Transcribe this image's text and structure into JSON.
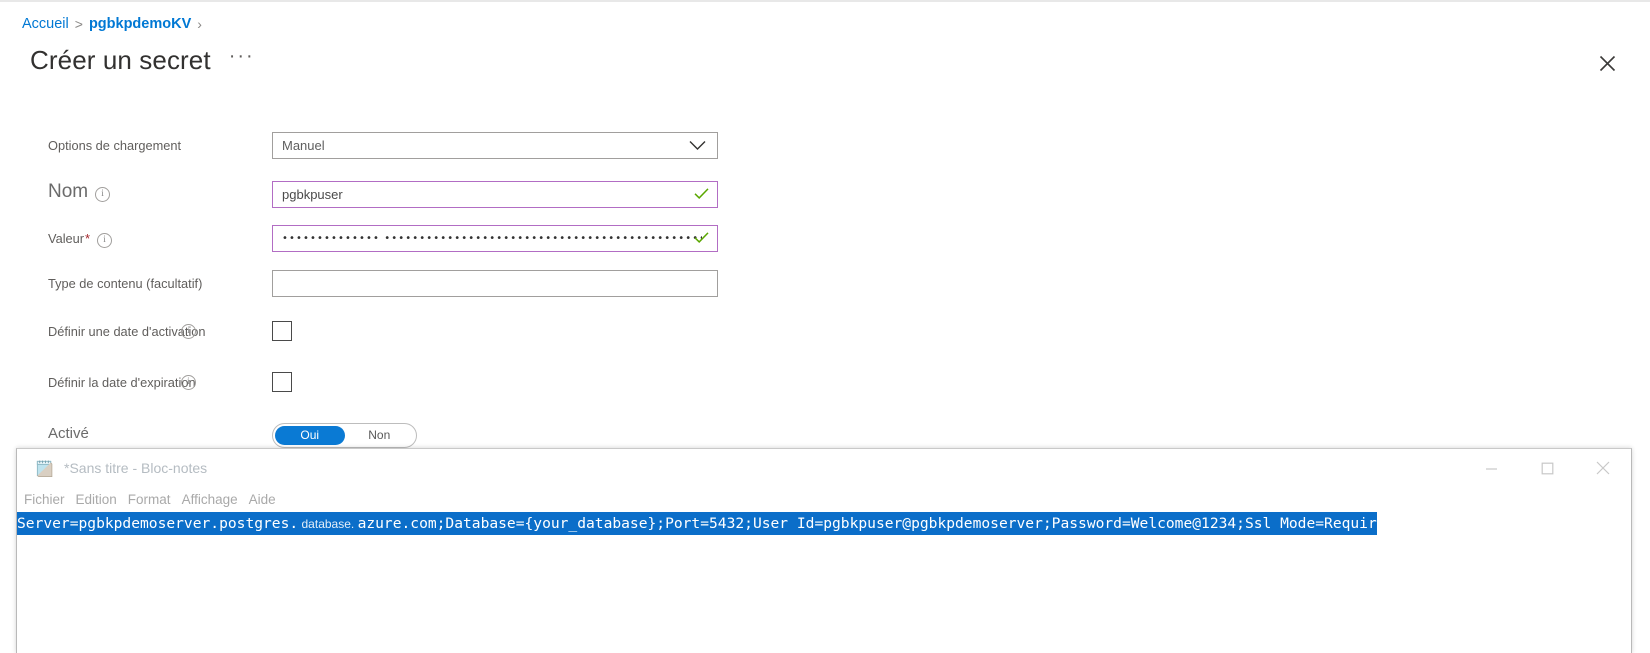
{
  "breadcrumb": {
    "home": "Accueil",
    "separator": ">",
    "current": "pgbkpdemoKV",
    "trailing": "›"
  },
  "blade": {
    "title": "Créer un secret",
    "more_label": "···",
    "close_icon": "close-icon"
  },
  "form": {
    "upload_options": {
      "label": "Options de chargement",
      "value": "Manuel",
      "chevron_icon": "chevron-down-icon"
    },
    "name": {
      "label": "Nom",
      "value": "pgbkpuser",
      "info_icon": "info-icon",
      "valid_icon": "check-icon"
    },
    "value": {
      "label": "Valeur",
      "required_marker": "*",
      "value": "•••••••••••••• •••••••••••••••••••••••••••••••••••••••••••••••••••••••••••••••••••••••••••••••••••",
      "info_icon": "info-icon",
      "valid_icon": "check-icon"
    },
    "content_type": {
      "label": "Type de contenu (facultatif)",
      "value": ""
    },
    "activation_date": {
      "label": "Définir une date d'activation",
      "checked": false
    },
    "expiration_date": {
      "label": "Définir la date d'expiration",
      "checked": false
    },
    "enabled": {
      "label": "Activé",
      "yes_label": "Oui",
      "no_label": "Non",
      "selected": "Oui"
    }
  },
  "notepad": {
    "title": "*Sans titre -  Bloc-notes",
    "app_icon": "notepad-icon",
    "menu": {
      "file": "Fichier",
      "edit": "Edition",
      "format": "Format",
      "view": "Affichage",
      "help": "Aide"
    },
    "window_controls": {
      "minimize_icon": "minimize-icon",
      "maximize_icon": "maximize-icon",
      "close_icon": "close-icon"
    },
    "content": {
      "part1": "Server=pgbkpdemoserver.postgres.",
      "faint": " database. ",
      "part2": "azure.com;Database={your_database};Port=5432;User Id=pgbkpuser@pgbkpdemoserver;Password=Welcome@1234;Ssl Mode=Requir"
    }
  },
  "colors": {
    "accent_blue": "#0078d4",
    "selection_blue": "#0b6ec9",
    "valid_purple": "#b26dc4",
    "valid_green": "#5aa700",
    "required_red": "#a4262c",
    "label_grey": "#605e5c"
  }
}
